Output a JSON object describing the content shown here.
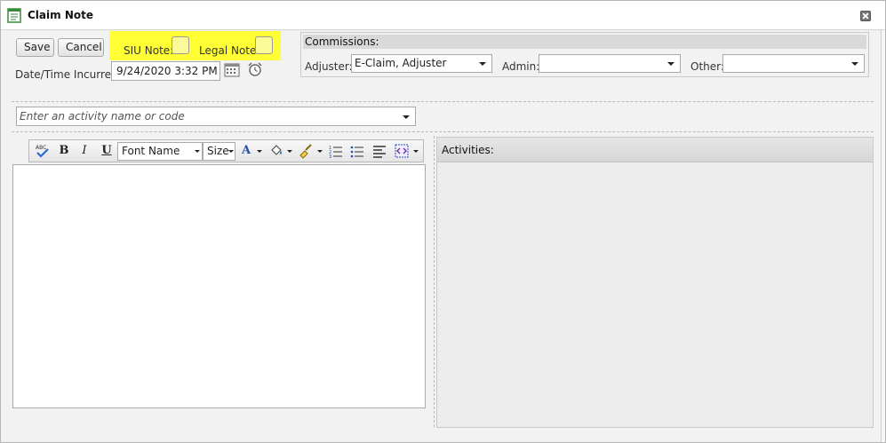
{
  "window": {
    "title": "Claim Note",
    "icon": "note-icon"
  },
  "toolbar": {
    "save_label": "Save",
    "cancel_label": "Cancel"
  },
  "flags": {
    "siu_label": "SIU Note:",
    "siu_checked": false,
    "legal_label": "Legal Note:",
    "legal_checked": false,
    "highlight_color": "#ffff33"
  },
  "incurred": {
    "label": "Date/Time Incurred:",
    "value": "9/24/2020 3:32 PM",
    "calendar_icon": "calendar-icon",
    "clock_icon": "alarm-clock-icon"
  },
  "commissions": {
    "header": "Commissions:",
    "adjuster_label": "Adjuster:",
    "adjuster_value": "E-Claim, Adjuster",
    "admin_label": "Admin:",
    "admin_value": "",
    "other_label": "Other:",
    "other_value": ""
  },
  "activity_select": {
    "placeholder": "Enter an activity name or code"
  },
  "editor": {
    "font_name": "Font Name",
    "size": "Size",
    "bold": "B",
    "italic": "I",
    "underline": "U"
  },
  "activities": {
    "header": "Activities:"
  }
}
